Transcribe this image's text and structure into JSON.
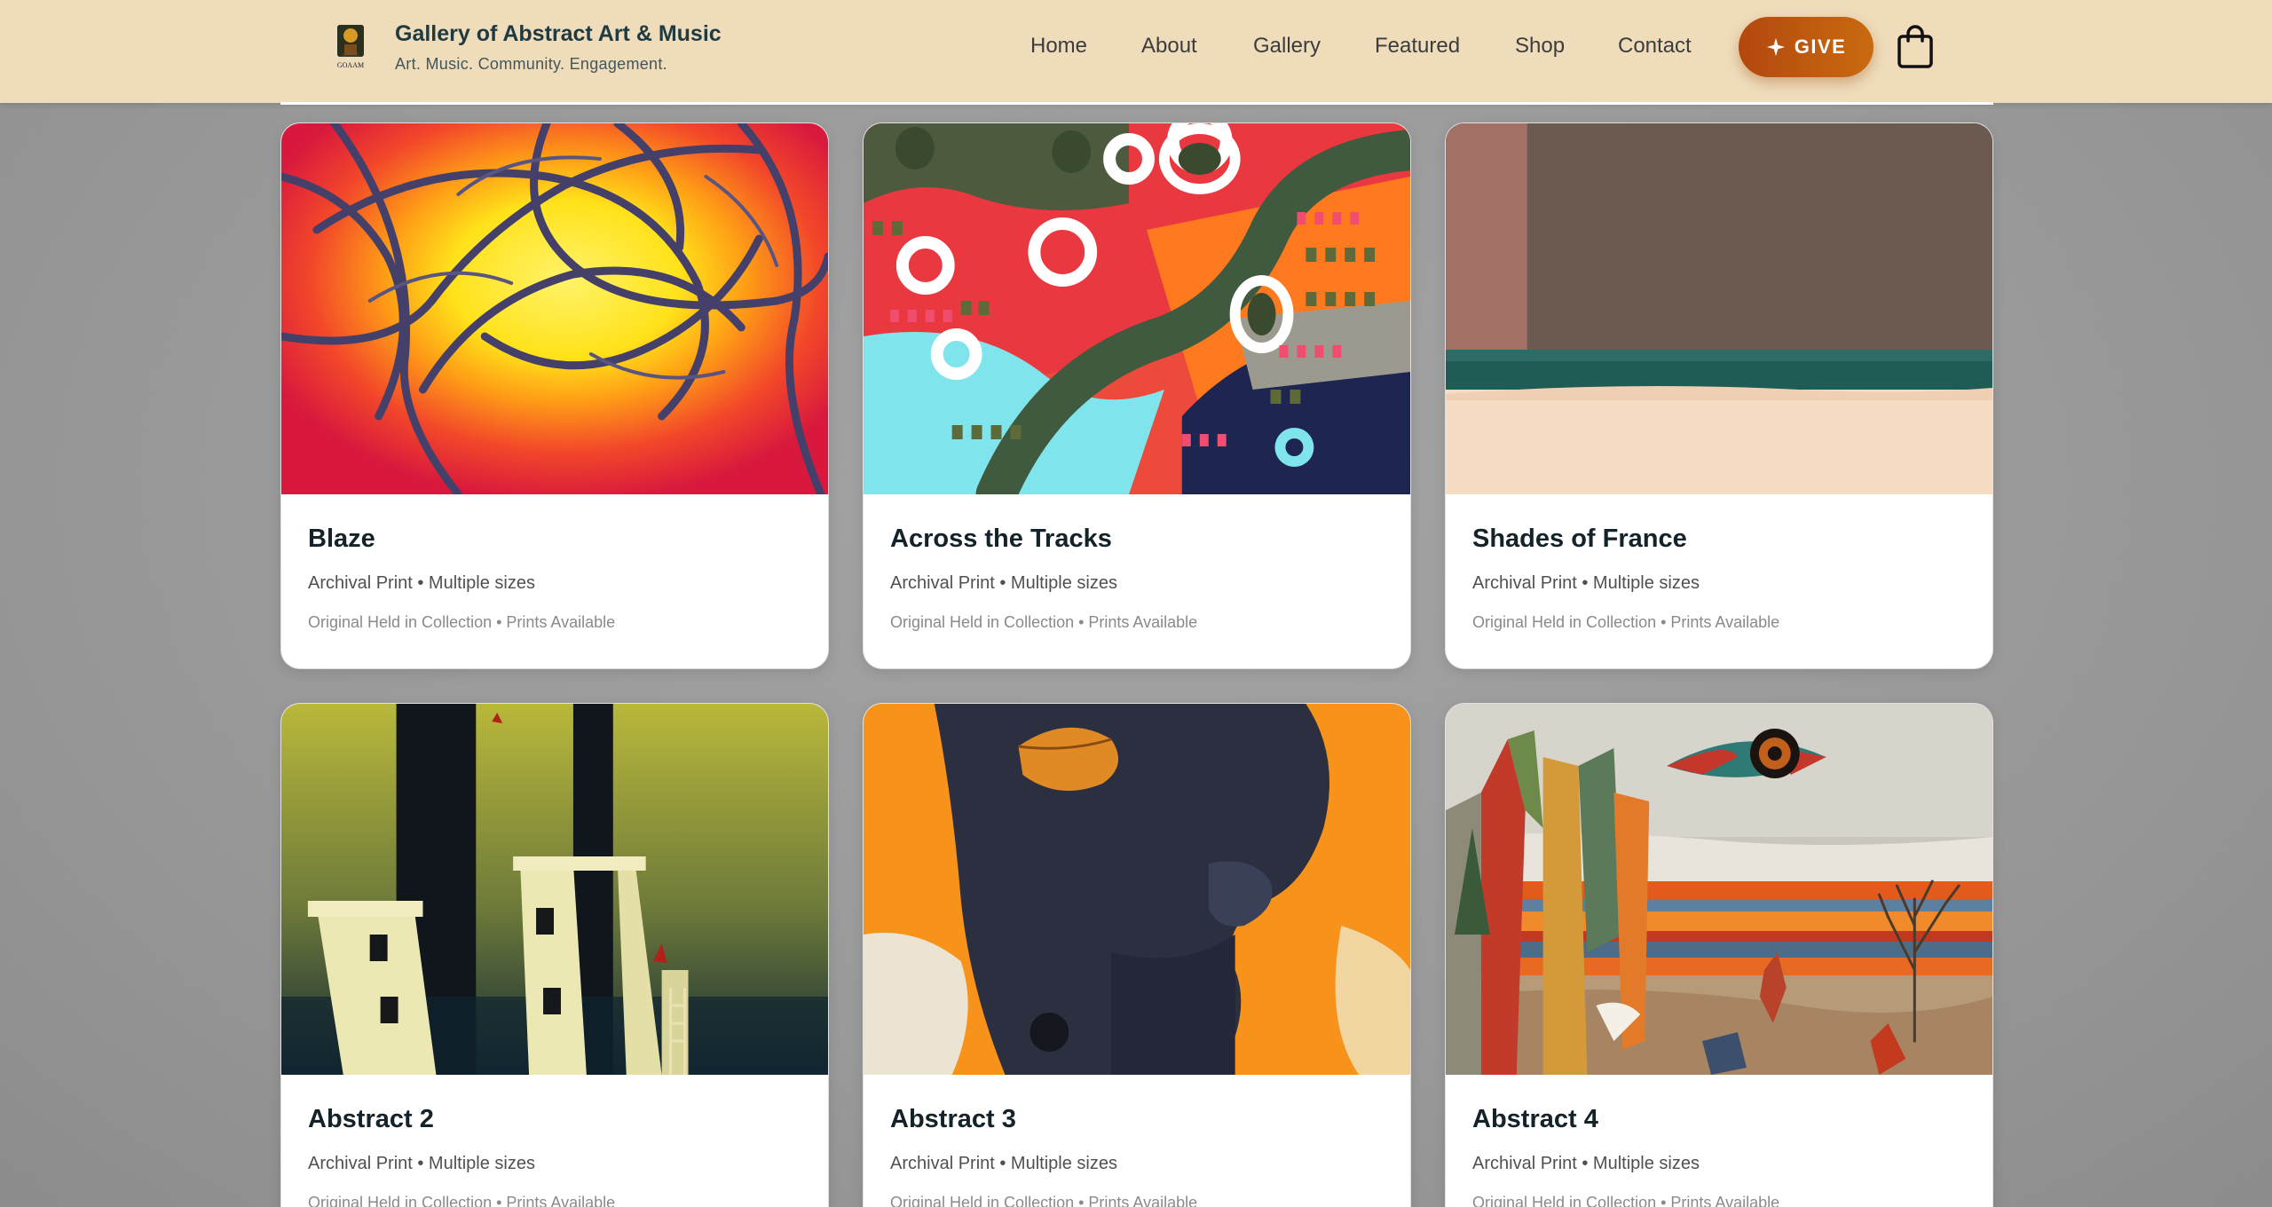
{
  "header": {
    "brand_title": "Gallery of Abstract Art & Music",
    "brand_tagline": "Art. Music. Community. Engagement.",
    "logo_text": "GOAAM",
    "nav": [
      "Home",
      "About",
      "Gallery",
      "Featured",
      "Shop",
      "Contact"
    ],
    "give_label": "GIVE",
    "give_icon": "sparkle-icon",
    "cart_icon": "shopping-bag-icon"
  },
  "colors": {
    "header_bg": "#efdcbb",
    "give_button": "#b8530f",
    "brand_text": "#1f3a40",
    "page_bg": "#9e9e9e"
  },
  "cards": [
    {
      "title": "Blaze",
      "meta": "Archival Print • Multiple sizes",
      "status": "Original Held in Collection • Prints Available"
    },
    {
      "title": "Across the Tracks",
      "meta": "Archival Print • Multiple sizes",
      "status": "Original Held in Collection • Prints Available"
    },
    {
      "title": "Shades of France",
      "meta": "Archival Print • Multiple sizes",
      "status": "Original Held in Collection • Prints Available"
    },
    {
      "title": "Abstract 2",
      "meta": "Archival Print • Multiple sizes",
      "status": "Original Held in Collection • Prints Available"
    },
    {
      "title": "Abstract 3",
      "meta": "Archival Print • Multiple sizes",
      "status": "Original Held in Collection • Prints Available"
    },
    {
      "title": "Abstract 4",
      "meta": "Archival Print • Multiple sizes",
      "status": "Original Held in Collection • Prints Available"
    }
  ]
}
